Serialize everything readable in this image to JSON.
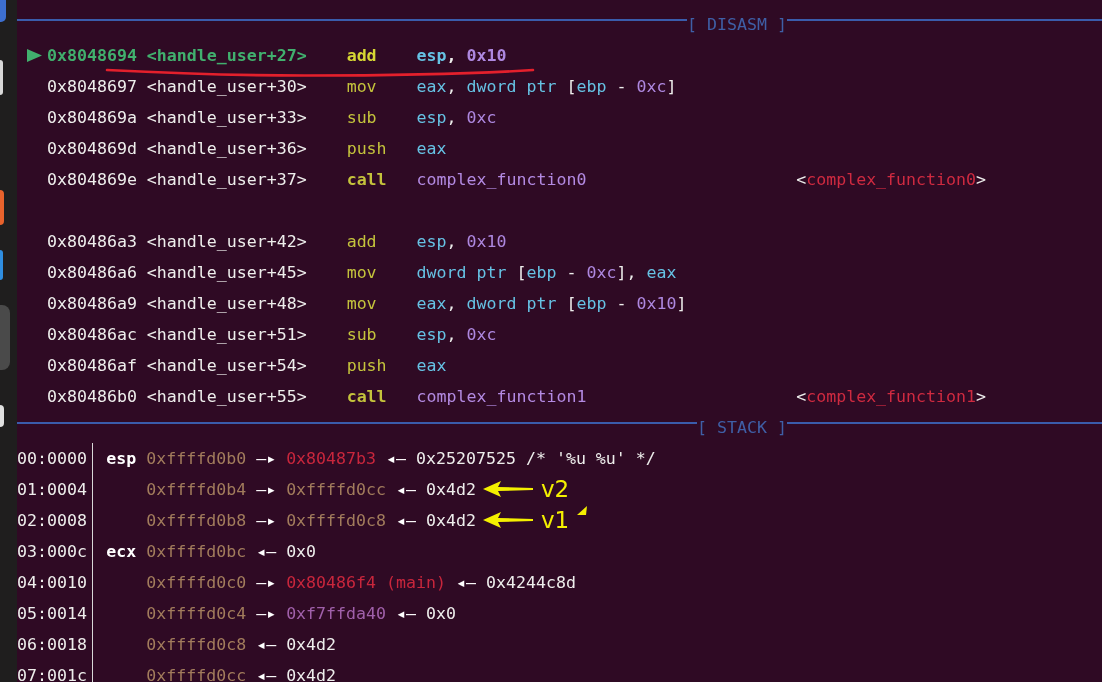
{
  "disasm": {
    "title": "[ DISASM ]",
    "blocks": [
      {
        "rows": [
          {
            "current": true,
            "underlined": true,
            "branch": false,
            "address": "0x8048694",
            "symbol": "<handle_user+27>",
            "mnemonic": "add",
            "operands": [
              {
                "text": "esp",
                "kind": "register"
              },
              {
                "text": ", ",
                "kind": "plain"
              },
              {
                "text": "0x10",
                "kind": "number"
              }
            ]
          },
          {
            "current": false,
            "underlined": false,
            "branch": false,
            "address": "0x8048697",
            "symbol": "<handle_user+30>",
            "mnemonic": "mov",
            "operands": [
              {
                "text": "eax",
                "kind": "register"
              },
              {
                "text": ", ",
                "kind": "plain"
              },
              {
                "text": "dword ptr",
                "kind": "register"
              },
              {
                "text": " [",
                "kind": "plain"
              },
              {
                "text": "ebp",
                "kind": "register"
              },
              {
                "text": " - ",
                "kind": "plain"
              },
              {
                "text": "0xc",
                "kind": "number"
              },
              {
                "text": "]",
                "kind": "plain"
              }
            ]
          },
          {
            "current": false,
            "underlined": false,
            "branch": false,
            "address": "0x804869a",
            "symbol": "<handle_user+33>",
            "mnemonic": "sub",
            "operands": [
              {
                "text": "esp",
                "kind": "register"
              },
              {
                "text": ", ",
                "kind": "plain"
              },
              {
                "text": "0xc",
                "kind": "number"
              }
            ]
          },
          {
            "current": false,
            "underlined": false,
            "branch": false,
            "address": "0x804869d",
            "symbol": "<handle_user+36>",
            "mnemonic": "push",
            "operands": [
              {
                "text": "eax",
                "kind": "register"
              }
            ]
          },
          {
            "current": false,
            "underlined": false,
            "branch": true,
            "address": "0x804869e",
            "symbol": "<handle_user+37>",
            "mnemonic": "call",
            "operands": [
              {
                "text": "complex_function0",
                "kind": "symbol"
              }
            ],
            "comment": [
              {
                "text": "<",
                "kind": "plain"
              },
              {
                "text": "complex_function0",
                "kind": "code"
              },
              {
                "text": ">",
                "kind": "plain"
              }
            ]
          }
        ]
      },
      {
        "rows": [
          {
            "current": false,
            "underlined": false,
            "branch": false,
            "address": "0x80486a3",
            "symbol": "<handle_user+42>",
            "mnemonic": "add",
            "operands": [
              {
                "text": "esp",
                "kind": "register"
              },
              {
                "text": ", ",
                "kind": "plain"
              },
              {
                "text": "0x10",
                "kind": "number"
              }
            ]
          },
          {
            "current": false,
            "underlined": false,
            "branch": false,
            "address": "0x80486a6",
            "symbol": "<handle_user+45>",
            "mnemonic": "mov",
            "operands": [
              {
                "text": "dword ptr",
                "kind": "register"
              },
              {
                "text": " [",
                "kind": "plain"
              },
              {
                "text": "ebp",
                "kind": "register"
              },
              {
                "text": " - ",
                "kind": "plain"
              },
              {
                "text": "0xc",
                "kind": "number"
              },
              {
                "text": "], ",
                "kind": "plain"
              },
              {
                "text": "eax",
                "kind": "register"
              }
            ]
          },
          {
            "current": false,
            "underlined": false,
            "branch": false,
            "address": "0x80486a9",
            "symbol": "<handle_user+48>",
            "mnemonic": "mov",
            "operands": [
              {
                "text": "eax",
                "kind": "register"
              },
              {
                "text": ", ",
                "kind": "plain"
              },
              {
                "text": "dword ptr",
                "kind": "register"
              },
              {
                "text": " [",
                "kind": "plain"
              },
              {
                "text": "ebp",
                "kind": "register"
              },
              {
                "text": " - ",
                "kind": "plain"
              },
              {
                "text": "0x10",
                "kind": "number"
              },
              {
                "text": "]",
                "kind": "plain"
              }
            ]
          },
          {
            "current": false,
            "underlined": false,
            "branch": false,
            "address": "0x80486ac",
            "symbol": "<handle_user+51>",
            "mnemonic": "sub",
            "operands": [
              {
                "text": "esp",
                "kind": "register"
              },
              {
                "text": ", ",
                "kind": "plain"
              },
              {
                "text": "0xc",
                "kind": "number"
              }
            ]
          },
          {
            "current": false,
            "underlined": false,
            "branch": false,
            "address": "0x80486af",
            "symbol": "<handle_user+54>",
            "mnemonic": "push",
            "operands": [
              {
                "text": "eax",
                "kind": "register"
              }
            ]
          },
          {
            "current": false,
            "underlined": false,
            "branch": true,
            "address": "0x80486b0",
            "symbol": "<handle_user+55>",
            "mnemonic": "call",
            "operands": [
              {
                "text": "complex_function1",
                "kind": "symbol"
              }
            ],
            "comment": [
              {
                "text": "<",
                "kind": "plain"
              },
              {
                "text": "complex_function1",
                "kind": "code"
              },
              {
                "text": ">",
                "kind": "plain"
              }
            ]
          }
        ]
      }
    ]
  },
  "stack": {
    "title": "[ STACK ]",
    "rows": [
      {
        "offset": "00:0000",
        "register": "esp",
        "chain": [
          {
            "text": "0xffffd0b0",
            "kind": "stack"
          },
          {
            "text": "—▸",
            "kind": "arrow"
          },
          {
            "text": "0x80487b3",
            "kind": "code"
          },
          {
            "text": "◂—",
            "kind": "arrow"
          },
          {
            "text": "0x25207525 /* '%u %u' */",
            "kind": "value"
          }
        ]
      },
      {
        "offset": "01:0004",
        "chain": [
          {
            "text": "0xffffd0b4",
            "kind": "stack"
          },
          {
            "text": "—▸",
            "kind": "arrow"
          },
          {
            "text": "0xffffd0cc",
            "kind": "stack"
          },
          {
            "text": "◂—",
            "kind": "arrow"
          },
          {
            "text": "0x4d2",
            "kind": "value"
          }
        ],
        "annotation": {
          "label": "v2",
          "pointer_mark": false
        }
      },
      {
        "offset": "02:0008",
        "chain": [
          {
            "text": "0xffffd0b8",
            "kind": "stack"
          },
          {
            "text": "—▸",
            "kind": "arrow"
          },
          {
            "text": "0xffffd0c8",
            "kind": "stack"
          },
          {
            "text": "◂—",
            "kind": "arrow"
          },
          {
            "text": "0x4d2",
            "kind": "value"
          }
        ],
        "annotation": {
          "label": "v1",
          "pointer_mark": true
        }
      },
      {
        "offset": "03:000c",
        "register": "ecx",
        "chain": [
          {
            "text": "0xffffd0bc",
            "kind": "stack"
          },
          {
            "text": "◂—",
            "kind": "arrow"
          },
          {
            "text": "0x0",
            "kind": "value"
          }
        ]
      },
      {
        "offset": "04:0010",
        "chain": [
          {
            "text": "0xffffd0c0",
            "kind": "stack"
          },
          {
            "text": "—▸",
            "kind": "arrow"
          },
          {
            "text": "0x80486f4 (main)",
            "kind": "code"
          },
          {
            "text": "◂—",
            "kind": "arrow"
          },
          {
            "text": "0x4244c8d",
            "kind": "value"
          }
        ]
      },
      {
        "offset": "05:0014",
        "chain": [
          {
            "text": "0xffffd0c4",
            "kind": "stack"
          },
          {
            "text": "—▸",
            "kind": "arrow"
          },
          {
            "text": "0xf7ffda40",
            "kind": "data"
          },
          {
            "text": "◂—",
            "kind": "arrow"
          },
          {
            "text": "0x0",
            "kind": "value"
          }
        ]
      },
      {
        "offset": "06:0018",
        "chain": [
          {
            "text": "0xffffd0c8",
            "kind": "stack"
          },
          {
            "text": "◂—",
            "kind": "arrow"
          },
          {
            "text": "0x4d2",
            "kind": "value"
          }
        ]
      },
      {
        "offset": "07:001c",
        "chain": [
          {
            "text": "0xffffd0cc",
            "kind": "stack"
          },
          {
            "text": "◂—",
            "kind": "arrow"
          },
          {
            "text": "0x4d2",
            "kind": "value"
          }
        ]
      }
    ]
  }
}
